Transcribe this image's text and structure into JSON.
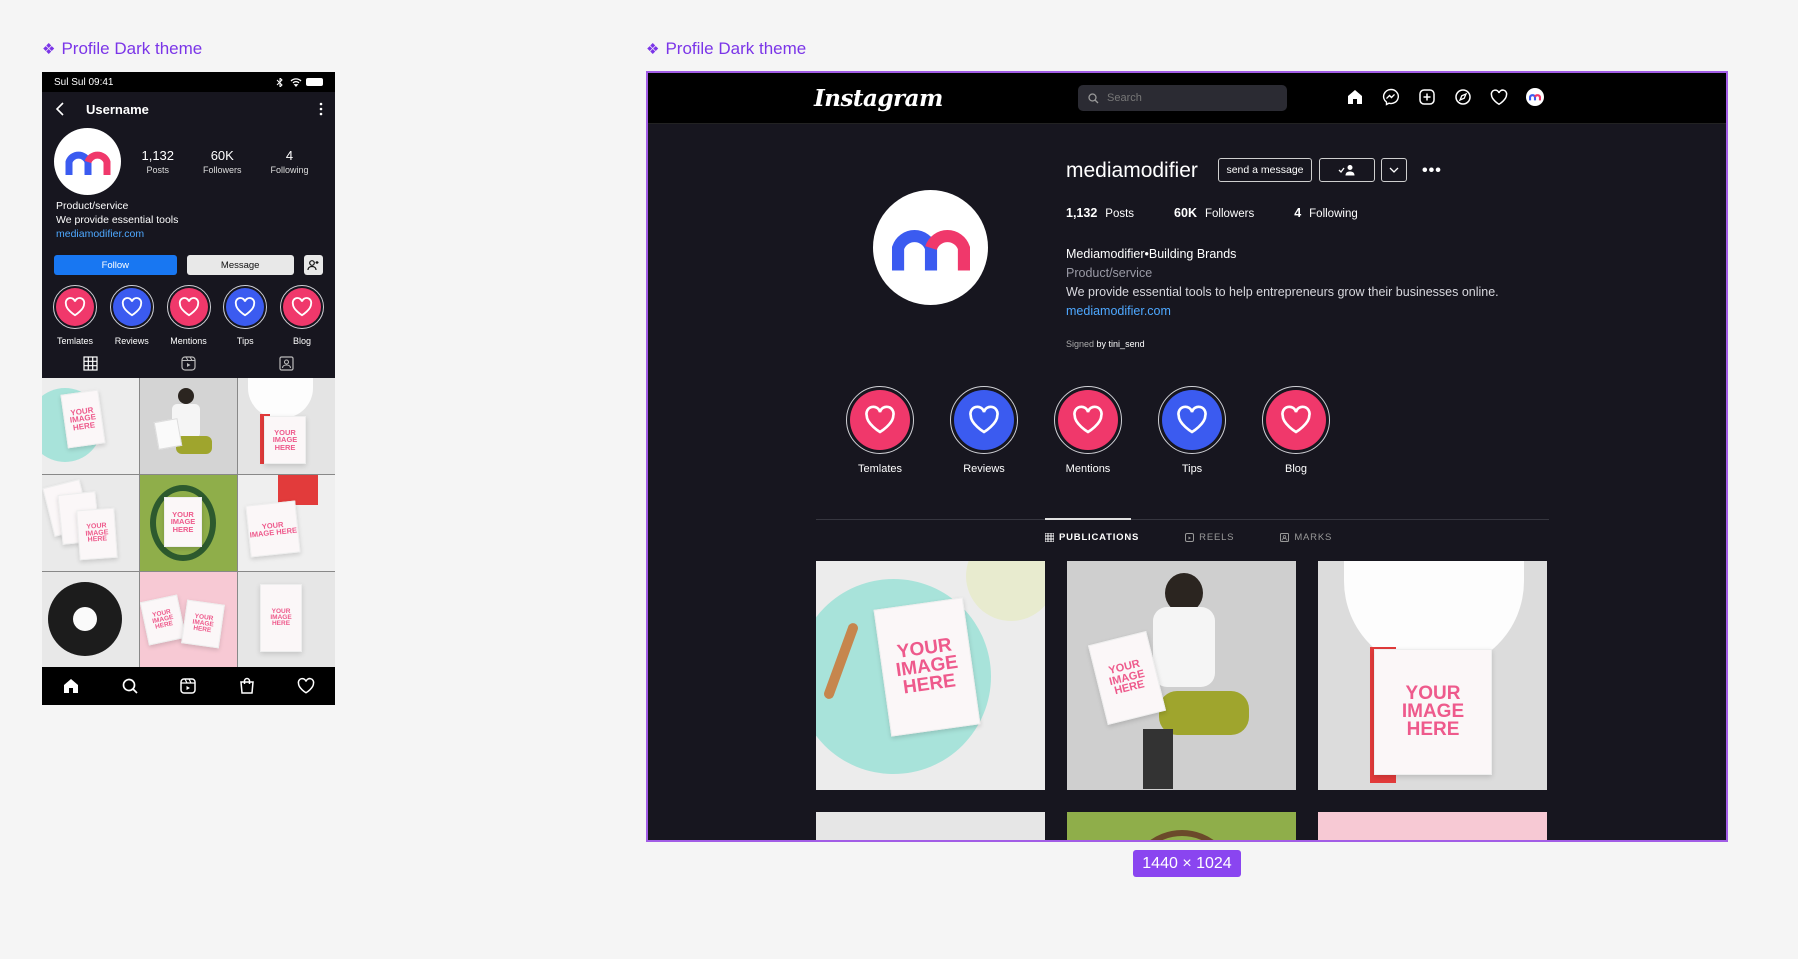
{
  "frames": {
    "mobile_label": "Profile Dark theme",
    "desktop_label": "Profile Dark theme",
    "size_badge": "1440 × 1024"
  },
  "mobile": {
    "status": {
      "left": "Sul Sul 09:41"
    },
    "header": {
      "username": "Username"
    },
    "stats": [
      {
        "value": "1,132",
        "label": "Posts"
      },
      {
        "value": "60K",
        "label": "Followers"
      },
      {
        "value": "4",
        "label": "Following"
      }
    ],
    "bio": {
      "category": "Product/service",
      "text": "We provide essential tools",
      "link": "mediamodifier.com"
    },
    "actions": {
      "follow": "Follow",
      "message": "Message"
    },
    "highlights": [
      {
        "label": "Temlates",
        "color": "#f0386b"
      },
      {
        "label": "Reviews",
        "color": "#3b5bf0"
      },
      {
        "label": "Mentions",
        "color": "#f0386b"
      },
      {
        "label": "Tips",
        "color": "#3b5bf0"
      },
      {
        "label": "Blog",
        "color": "#f0386b"
      }
    ],
    "mockup_text": "YOUR IMAGE HERE"
  },
  "desktop": {
    "logo": "Instagram",
    "search_placeholder": "Search",
    "username": "mediamodifier",
    "send_message": "send a message",
    "stats": [
      {
        "value": "1,132",
        "label": "Posts"
      },
      {
        "value": "60K",
        "label": "Followers"
      },
      {
        "value": "4",
        "label": "Following"
      }
    ],
    "bio": {
      "name": "Mediamodifier•Building Brands",
      "category": "Product/service",
      "text": "We provide essential tools to help entrepreneurs grow their businesses online.",
      "link": "mediamodifier.com"
    },
    "signed": {
      "prefix": "Signed",
      "by": "by tini_send"
    },
    "highlights": [
      {
        "label": "Temlates",
        "color": "#f0386b"
      },
      {
        "label": "Reviews",
        "color": "#3b5bf0"
      },
      {
        "label": "Mentions",
        "color": "#f0386b"
      },
      {
        "label": "Tips",
        "color": "#3b5bf0"
      },
      {
        "label": "Blog",
        "color": "#f0386b"
      }
    ],
    "tabs": [
      {
        "label": "PUBLICATIONS",
        "active": true
      },
      {
        "label": "REELS",
        "active": false
      },
      {
        "label": "MARKS",
        "active": false
      }
    ]
  },
  "colors": {
    "bg_dark": "#17161f",
    "accent_purple": "#8a45f0",
    "link_blue": "#4ea8ff",
    "follow_blue": "#1877f2",
    "highlight_pink": "#f0386b",
    "highlight_blue": "#3b5bf0"
  }
}
